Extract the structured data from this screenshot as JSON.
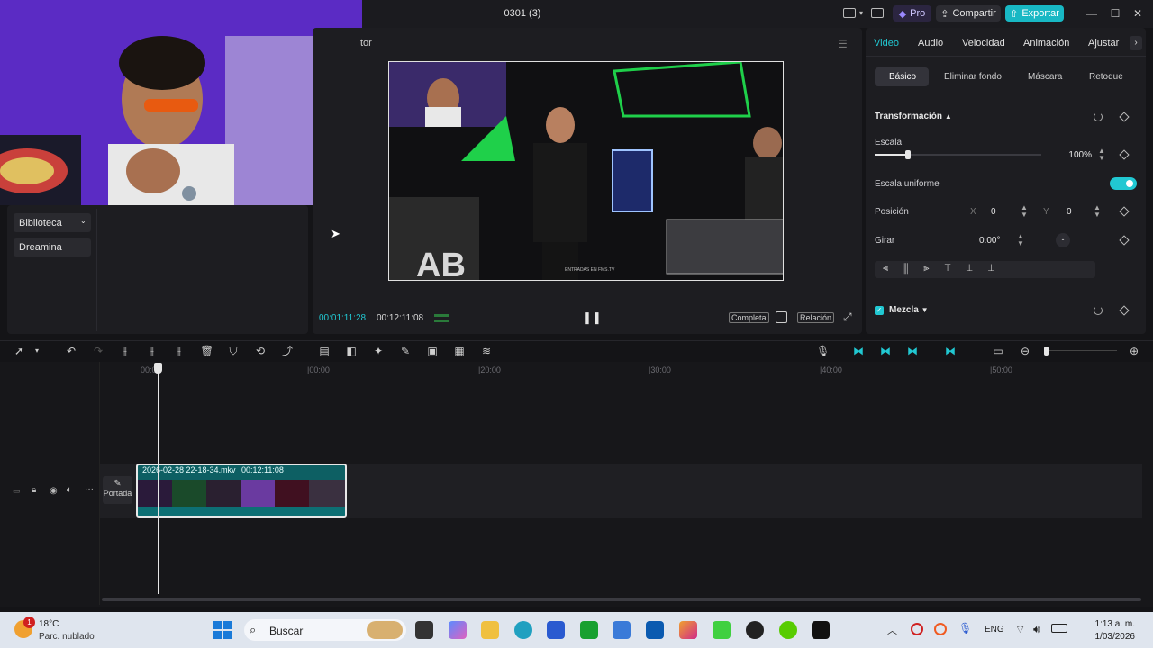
{
  "window": {
    "title": "0301 (3)"
  },
  "header": {
    "pro_label": "Pro",
    "share_label": "Compartir",
    "export_label": "Exportar"
  },
  "player": {
    "title_fragment": "tor",
    "time_current": "00:01:11:28",
    "time_total": "00:12:11:08",
    "full_label": "Completa",
    "ratio_label": "Relación",
    "video_overlay_text": "ENTRADAS EN FMS.TV"
  },
  "left_panel": {
    "items": [
      {
        "label": "Biblioteca"
      },
      {
        "label": "Dreamina"
      }
    ]
  },
  "properties": {
    "tabs": [
      "Video",
      "Audio",
      "Velocidad",
      "Animación",
      "Ajustar"
    ],
    "active_tab": "Video",
    "subtabs": [
      "Básico",
      "Eliminar fondo",
      "Máscara",
      "Retoque"
    ],
    "active_subtab": "Básico",
    "section_transform": "Transformación",
    "scale_label": "Escala",
    "scale_value": "100%",
    "scale_fraction": 0.2,
    "uniform_scale_label": "Escala uniforme",
    "uniform_scale_on": true,
    "position_label": "Posición",
    "pos_x_label": "X",
    "pos_x_value": "0",
    "pos_y_label": "Y",
    "pos_y_value": "0",
    "rotate_label": "Girar",
    "rotate_value": "0.00°",
    "blend_label": "Mezcla",
    "accent": "#21c8d2"
  },
  "timeline": {
    "ruler": [
      "00:00",
      "|00:00",
      "|20:00",
      "|30:00",
      "|40:00",
      "|50:00"
    ],
    "clip_name": "2026-02-28 22-18-34.mkv",
    "clip_duration": "00:12:11:08",
    "cover_label": "Portada"
  },
  "taskbar": {
    "weather_temp": "18°C",
    "weather_desc": "Parc. nublado",
    "weather_badge": "1",
    "search_placeholder": "Buscar",
    "language": "ENG",
    "time": "1:13 a. m.",
    "date": "1/03/2026"
  }
}
